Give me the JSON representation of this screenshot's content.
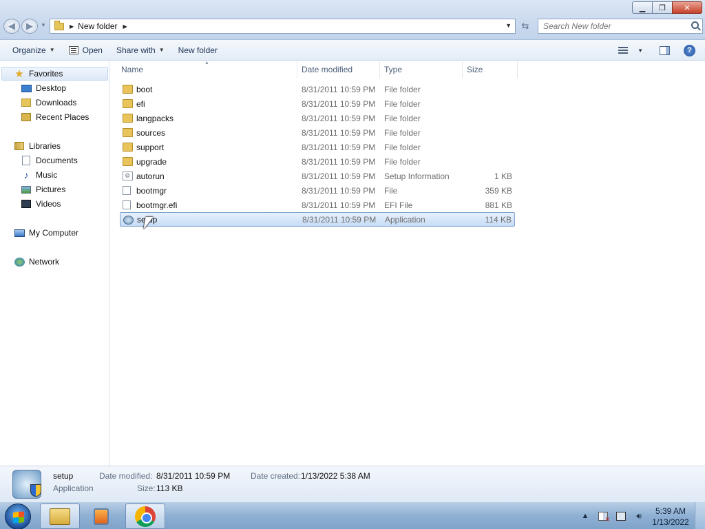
{
  "window": {
    "minimize_glyph": "▁",
    "maximize_glyph": "❐",
    "close_glyph": "✕"
  },
  "address": {
    "path": [
      "New folder"
    ],
    "current": "New folder"
  },
  "search": {
    "placeholder": "Search New folder"
  },
  "toolbar": {
    "organize": "Organize",
    "open": "Open",
    "share_with": "Share with",
    "new_folder": "New folder"
  },
  "navpane": {
    "favorites": "Favorites",
    "desktop": "Desktop",
    "downloads": "Downloads",
    "recent_places": "Recent Places",
    "libraries": "Libraries",
    "documents": "Documents",
    "music": "Music",
    "pictures": "Pictures",
    "videos": "Videos",
    "my_computer": "My Computer",
    "network": "Network"
  },
  "columns": {
    "name": "Name",
    "date_modified": "Date modified",
    "type": "Type",
    "size": "Size"
  },
  "files": [
    {
      "name": "boot",
      "date": "8/31/2011 10:59 PM",
      "type": "File folder",
      "size": "",
      "icon": "folder-icon"
    },
    {
      "name": "efi",
      "date": "8/31/2011 10:59 PM",
      "type": "File folder",
      "size": "",
      "icon": "folder-icon"
    },
    {
      "name": "langpacks",
      "date": "8/31/2011 10:59 PM",
      "type": "File folder",
      "size": "",
      "icon": "folder-icon"
    },
    {
      "name": "sources",
      "date": "8/31/2011 10:59 PM",
      "type": "File folder",
      "size": "",
      "icon": "folder-icon"
    },
    {
      "name": "support",
      "date": "8/31/2011 10:59 PM",
      "type": "File folder",
      "size": "",
      "icon": "folder-icon"
    },
    {
      "name": "upgrade",
      "date": "8/31/2011 10:59 PM",
      "type": "File folder",
      "size": "",
      "icon": "folder-icon"
    },
    {
      "name": "autorun",
      "date": "8/31/2011 10:59 PM",
      "type": "Setup Information",
      "size": "1 KB",
      "icon": "setup-info-icon"
    },
    {
      "name": "bootmgr",
      "date": "8/31/2011 10:59 PM",
      "type": "File",
      "size": "359 KB",
      "icon": "file-icon"
    },
    {
      "name": "bootmgr.efi",
      "date": "8/31/2011 10:59 PM",
      "type": "EFI File",
      "size": "881 KB",
      "icon": "file-icon"
    },
    {
      "name": "setup",
      "date": "8/31/2011 10:59 PM",
      "type": "Application",
      "size": "114 KB",
      "icon": "application-icon"
    }
  ],
  "details": {
    "name": "setup",
    "type": "Application",
    "date_modified_label": "Date modified:",
    "date_modified": "8/31/2011 10:59 PM",
    "date_created_label": "Date created:",
    "date_created": "1/13/2022 5:38 AM",
    "size_label": "Size:",
    "size": "113 KB"
  },
  "taskbar": {
    "time": "5:39 AM",
    "date": "1/13/2022"
  }
}
